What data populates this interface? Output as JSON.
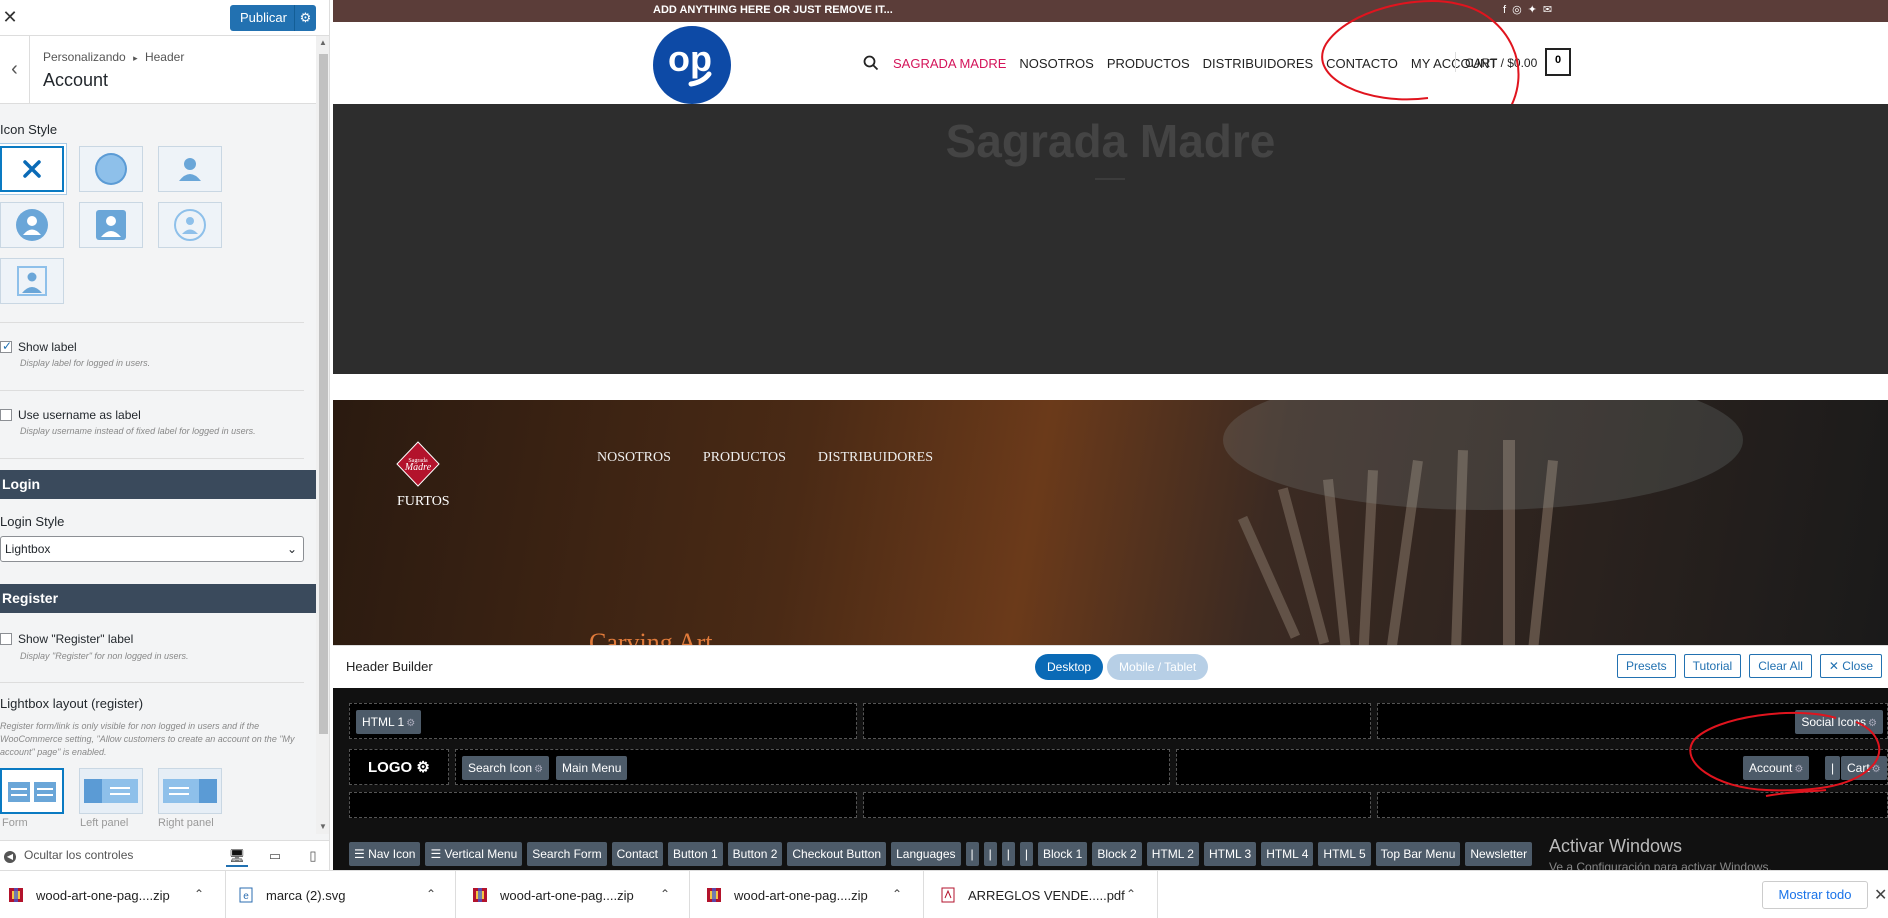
{
  "sidebar": {
    "close_label": "✕",
    "publish_label": "Publicar",
    "breadcrumb_a": "Personalizando",
    "breadcrumb_sep": "▸",
    "breadcrumb_b": "Header",
    "panel_title": "Account",
    "icon_style_label": "Icon Style",
    "show_label_title": "Show label",
    "show_label_desc": "Display label for logged in users.",
    "show_label_checked": true,
    "use_username_title": "Use username as label",
    "use_username_desc": "Display username instead of fixed label for logged in users.",
    "login_section": "Login",
    "login_style_label": "Login Style",
    "login_style_value": "Lightbox",
    "register_section": "Register",
    "show_register_title": "Show \"Register\" label",
    "show_register_desc": "Display \"Register\" for non logged in users.",
    "lightbox_layout_label": "Lightbox layout (register)",
    "lightbox_desc": "Register form/link is only visible for non logged in users and if the WooCommerce setting, \"Allow customers to create an account on the \"My account\" page\" is enabled.",
    "layout_form": "Form",
    "layout_left": "Left panel",
    "layout_right": "Right panel",
    "hide_controls": "Ocultar los controles"
  },
  "preview": {
    "topbar_text": "ADD ANYTHING HERE OR JUST REMOVE IT...",
    "logo_text": "op",
    "nav": [
      "SAGRADA MADRE",
      "NOSOTROS",
      "PRODUCTOS",
      "DISTRIBUIDORES",
      "CONTACTO",
      "MY ACCOUNT"
    ],
    "cart_label": "CART / $0.00",
    "cart_count": "0",
    "hero_title": "Sagrada Madre",
    "brand_logo_a": "Sagrada",
    "brand_logo_b": "Madre",
    "brand_name": "FURTOS",
    "nav2": [
      "NOSOTROS",
      "PRODUCTOS",
      "DISTRIBUIDORES"
    ],
    "carving_text": "Carving Art"
  },
  "builder": {
    "title": "Header Builder",
    "desktop": "Desktop",
    "mobile": "Mobile / Tablet",
    "presets": "Presets",
    "tutorial": "Tutorial",
    "clear_all": "Clear All",
    "close": "✕ Close",
    "html1": "HTML 1",
    "social_icons": "Social Icons",
    "logo": "LOGO",
    "search_icon": "Search Icon",
    "main_menu": "Main Menu",
    "account": "Account",
    "divider": "|",
    "cart": "Cart",
    "elements": [
      "☰ Nav Icon",
      "☰ Vertical Menu",
      "Search Form",
      "Contact",
      "Button 1",
      "Button 2",
      "Checkout Button",
      "Languages",
      "|",
      "|",
      "|",
      "|",
      "Block 1",
      "Block 2",
      "HTML 2",
      "HTML 3",
      "HTML 4",
      "HTML 5",
      "Top Bar Menu",
      "Newsletter"
    ],
    "activate_title": "Activar Windows",
    "activate_sub": "Ve a Configuración para activar Windows."
  },
  "downloads": {
    "items": [
      "wood-art-one-pag....zip",
      "marca (2).svg",
      "wood-art-one-pag....zip",
      "wood-art-one-pag....zip",
      "ARREGLOS VENDE.....pdf"
    ],
    "show_all": "Mostrar todo",
    "close": "✕"
  },
  "colors": {
    "accent": "#2271b1",
    "nav_active": "#d4145a",
    "topbar": "#5b3d39",
    "annotation_red": "#e0141e"
  }
}
